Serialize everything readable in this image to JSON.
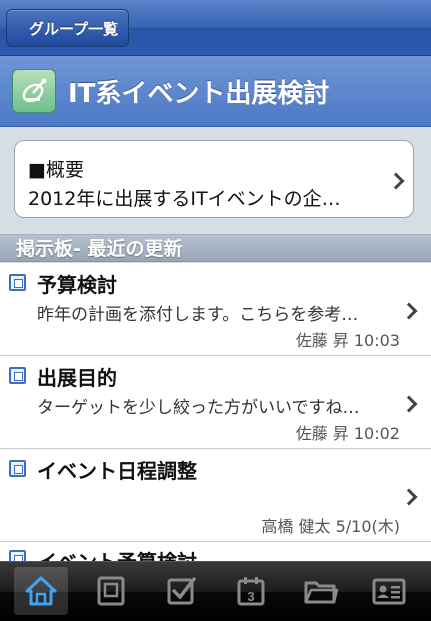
{
  "nav": {
    "back_label": "グループ一覧"
  },
  "header": {
    "title": "IT系イベント出展検討",
    "icon": "group-satellite-icon"
  },
  "overview": {
    "title": "■概要",
    "body": "2012年に出展するITイベントの企…"
  },
  "section": {
    "title": "掲示板- 最近の更新"
  },
  "posts": [
    {
      "title": "予算検討",
      "preview": "昨年の計画を添付します。こちらを参考…",
      "meta": "佐藤 昇 10:03"
    },
    {
      "title": "出展目的",
      "preview": "ターゲットを少し絞った方がいいですね…",
      "meta": "佐藤 昇 10:02"
    },
    {
      "title": "イベント日程調整",
      "preview": "",
      "meta": "高橋 健太 5/10(木)"
    },
    {
      "title": "イベント予算検討",
      "preview": "",
      "meta": ""
    }
  ],
  "tabbar": {
    "items": [
      "home-icon",
      "board-icon",
      "todo-icon",
      "calendar-icon",
      "folder-icon",
      "contacts-icon"
    ],
    "calendar_day": "3",
    "active": "home-icon"
  },
  "colors": {
    "nav_blue": "#3563b4",
    "header_blue": "#5a86cd",
    "icon_blue": "#3a6fc2",
    "tab_active": "#3ea4ef"
  }
}
